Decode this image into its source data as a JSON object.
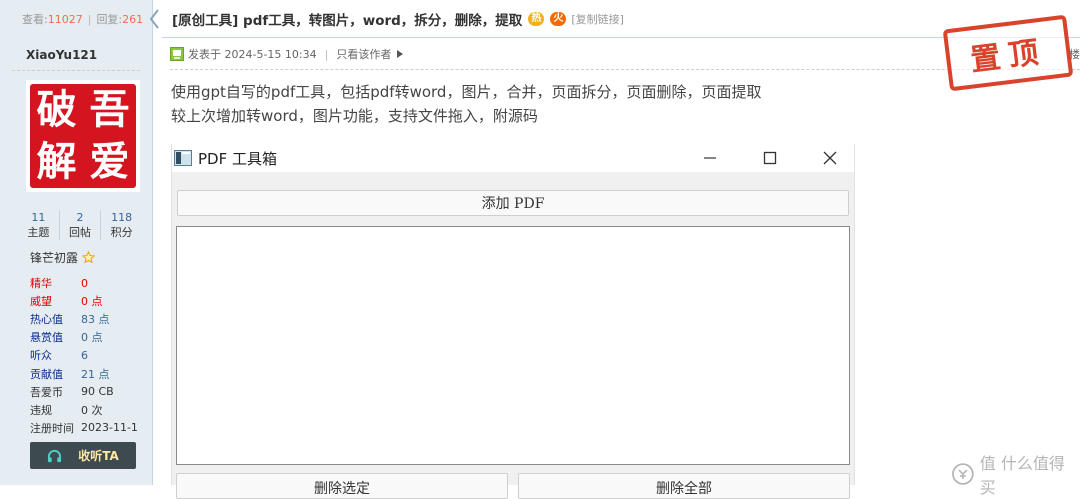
{
  "thread_stats": {
    "views_label": "查看:",
    "views": "11027",
    "separator": "|",
    "replies_label": "回复:",
    "replies": "261"
  },
  "user": {
    "name": "XiaoYu121",
    "avatar_chars": [
      "破",
      "吾",
      "解",
      "爱"
    ],
    "counts": [
      {
        "value": "11",
        "label": "主题"
      },
      {
        "value": "2",
        "label": "回帖"
      },
      {
        "value": "118",
        "label": "积分"
      }
    ],
    "rank": "锋芒初露",
    "attributes": [
      {
        "key": "精华",
        "value": "0",
        "color": "#e60000",
        "value_color": "#e60000"
      },
      {
        "key": "威望",
        "value": "0 点",
        "color": "#e60000",
        "value_color": "#e60000"
      },
      {
        "key": "热心值",
        "value": "83 点",
        "color": "#0a2b8f",
        "value_color": "#336699"
      },
      {
        "key": "悬赏值",
        "value": "0 点",
        "color": "#0a2b8f",
        "value_color": "#336699"
      },
      {
        "key": "听众",
        "value": "6",
        "color": "#0a2b8f",
        "value_color": "#336699"
      },
      {
        "key": "贡献值",
        "value": "21 点",
        "color": "#0a2b8f",
        "value_color": "#336699"
      },
      {
        "key": "吾爱币",
        "value": "90 CB",
        "color": "#333333",
        "value_color": "#333333"
      },
      {
        "key": "违规",
        "value": "0 次",
        "color": "#333333",
        "value_color": "#333333"
      },
      {
        "key": "注册时间",
        "value": "2023-11-1",
        "color": "#333333",
        "value_color": "#333333"
      }
    ],
    "listen_button": "收听TA"
  },
  "post": {
    "title": "[原创工具] pdf工具，转图片，word，拆分，删除，提取",
    "badge_a": "热",
    "badge_b": "火",
    "copy_link": "[复制链接]",
    "posted_at": "发表于 2024-5-15 10:34",
    "meta_separator": "|",
    "author_only": "只看该作者",
    "stamp": "置顶",
    "floor": "楼",
    "body_lines": [
      "使用gpt自写的pdf工具，包括pdf转word，图片，合并，页面拆分，页面删除，页面提取",
      "较上次增加转word，图片功能，支持文件拖入，附源码"
    ]
  },
  "app": {
    "title": "PDF 工具箱",
    "add_button": "添加 PDF",
    "delete_selected": "删除选定",
    "delete_all": "删除全部"
  },
  "watermark": "值 什么值得买",
  "colors": {
    "sidebar_bg": "#e5edf2",
    "border": "#c2d5e3",
    "accent_orange": "#f26c4f",
    "stamp_red": "#d9432b",
    "avatar_red": "#d4141e",
    "button_dark": "#3d4b51"
  }
}
